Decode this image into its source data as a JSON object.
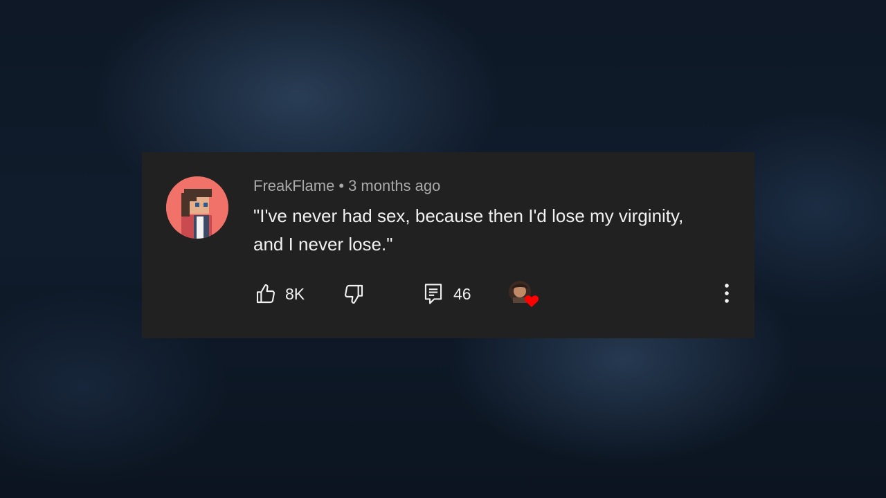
{
  "comment": {
    "author": "FreakFlame",
    "separator": "•",
    "timestamp": "3 months ago",
    "text_line1": "\"I've never had sex, because then I'd lose my virginity,",
    "text_line2": "and I never lose.\""
  },
  "actions": {
    "like_count": "8K",
    "reply_count": "46"
  },
  "icons": {
    "like": "thumbs-up-icon",
    "dislike": "thumbs-down-icon",
    "replies": "comment-icon",
    "creator_heart": "heart-icon",
    "more": "more-vert-icon"
  },
  "colors": {
    "card_background": "#212121",
    "avatar_background": "#f07268",
    "meta_text": "#aaaaaa",
    "body_text": "#f1f1f1",
    "heart": "#ff0000"
  }
}
